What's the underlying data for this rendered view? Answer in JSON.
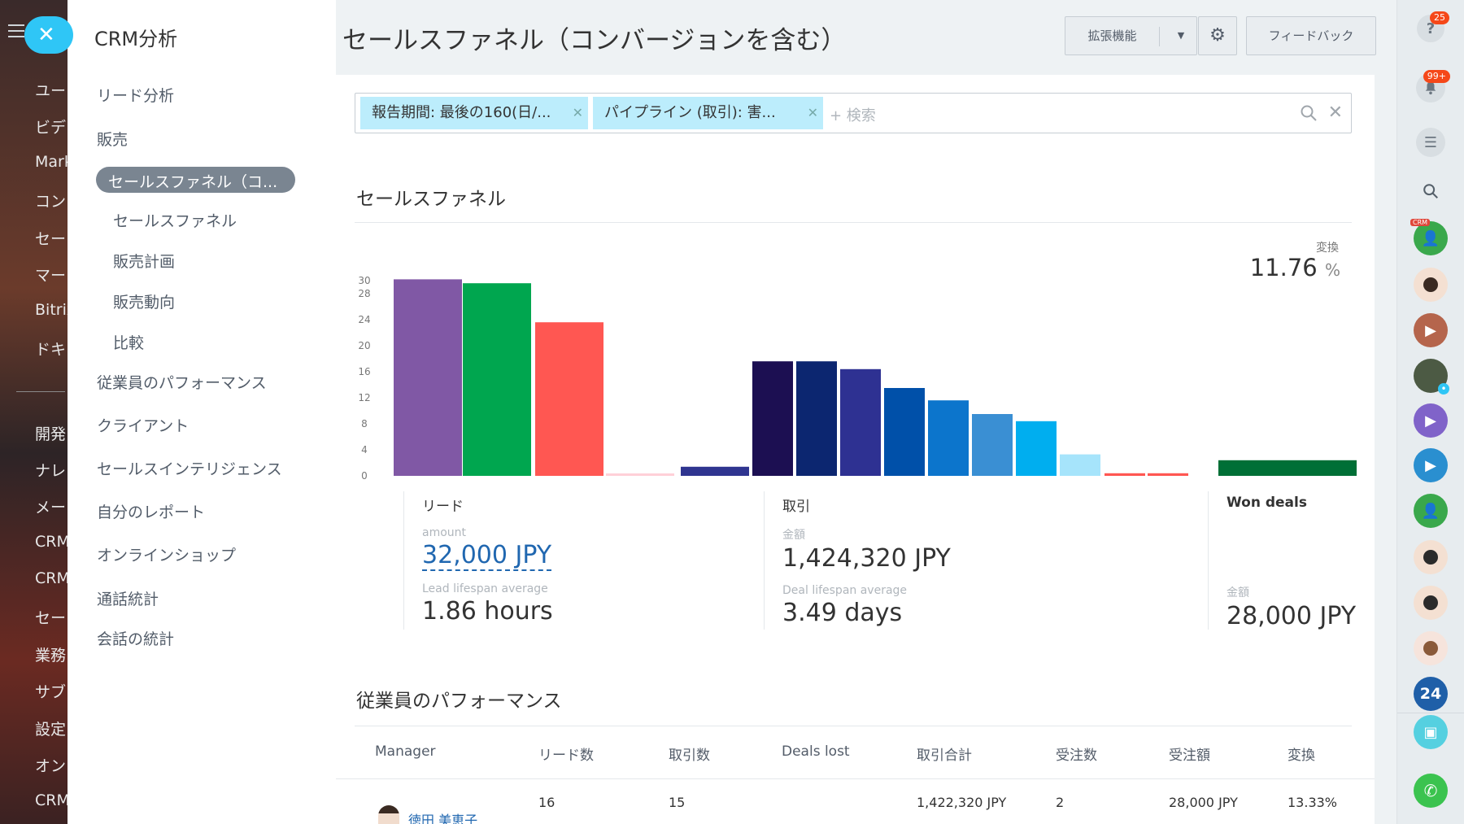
{
  "background_menu": {
    "items": [
      "ユー",
      "ビデ",
      "Mark",
      "コン",
      "セー",
      "マー",
      "Bitrix",
      "ドキ",
      "開発",
      "ナレ",
      "メー",
      "CRM",
      "CRM",
      "セー",
      "業務",
      "サブ",
      "設定",
      "オン",
      "CRM"
    ]
  },
  "left_panel": {
    "title": "CRM分析",
    "items": [
      {
        "label": "リード分析",
        "level": "main"
      },
      {
        "label": "販売",
        "level": "main"
      },
      {
        "label": "セールスファネル（コ...",
        "level": "active"
      },
      {
        "label": "セールスファネル",
        "level": "sub"
      },
      {
        "label": "販売計画",
        "level": "sub"
      },
      {
        "label": "販売動向",
        "level": "sub"
      },
      {
        "label": "比較",
        "level": "sub"
      },
      {
        "label": "従業員のパフォーマンス",
        "level": "main"
      },
      {
        "label": "クライアント",
        "level": "main"
      },
      {
        "label": "セールスインテリジェンス",
        "level": "main"
      },
      {
        "label": "自分のレポート",
        "level": "main"
      },
      {
        "label": "オンラインショップ",
        "level": "main"
      },
      {
        "label": "通話統計",
        "level": "main"
      },
      {
        "label": "会話の統計",
        "level": "main"
      }
    ]
  },
  "header": {
    "title": "セールスファネル（コンバージョンを含む）",
    "extensions_label": "拡張機能",
    "feedback_label": "フィードバック"
  },
  "filter": {
    "chips": [
      "報告期間: 最後の160(日/...",
      "パイプライン (取引): 害..."
    ],
    "placeholder": "+ 検索"
  },
  "funnel": {
    "title": "セールスファネル",
    "conversion_label": "変換",
    "conversion_value": "11.76",
    "conversion_unit": "%"
  },
  "chart_data": {
    "type": "bar",
    "y_ticks": [
      0,
      4,
      8,
      12,
      16,
      20,
      24,
      28,
      30
    ],
    "ylim": [
      0,
      30
    ],
    "values": [
      30.2,
      29.6,
      23.6,
      0.3,
      1.4,
      17.6,
      17.6,
      16.4,
      13.5,
      11.6,
      9.5,
      8.4,
      3.3,
      0.4,
      0.4,
      2.4
    ],
    "colors": [
      "#8058a5",
      "#00a64f",
      "#ff5752",
      "#ffd0d8",
      "#2f3590",
      "#1c0f52",
      "#0c2670",
      "#2e3192",
      "#0050a9",
      "#0c75cc",
      "#3a8fd3",
      "#00aeef",
      "#a6e4fb",
      "#ff5752",
      "#ff5752",
      "#006f36"
    ]
  },
  "stats": {
    "leads": {
      "title": "リード",
      "amount_label": "amount",
      "amount": "32,000 JPY",
      "lifespan_label": "Lead lifespan average",
      "lifespan": "1.86 hours"
    },
    "deals": {
      "title": "取引",
      "amount_label": "金額",
      "amount": "1,424,320 JPY",
      "lifespan_label": "Deal lifespan average",
      "lifespan": "3.49 days"
    },
    "won": {
      "title": "Won deals",
      "amount_label": "金額",
      "amount": "28,000 JPY"
    }
  },
  "performance": {
    "title": "従業員のパフォーマンス",
    "columns": [
      "Manager",
      "リード数",
      "取引数",
      "Deals lost",
      "取引合計",
      "受注数",
      "受注額",
      "変換"
    ],
    "rows": [
      {
        "manager": "徳田 美恵子",
        "leads": "16",
        "deals": "15",
        "lost": "",
        "total": "1,422,320 JPY",
        "won": "2",
        "won_amount": "28,000 JPY",
        "conversion": "13.33%"
      }
    ]
  },
  "right_bar": {
    "help_badge": "25",
    "notify_badge": "99+",
    "crm_tag": "CRM",
    "brand_number": "24"
  }
}
